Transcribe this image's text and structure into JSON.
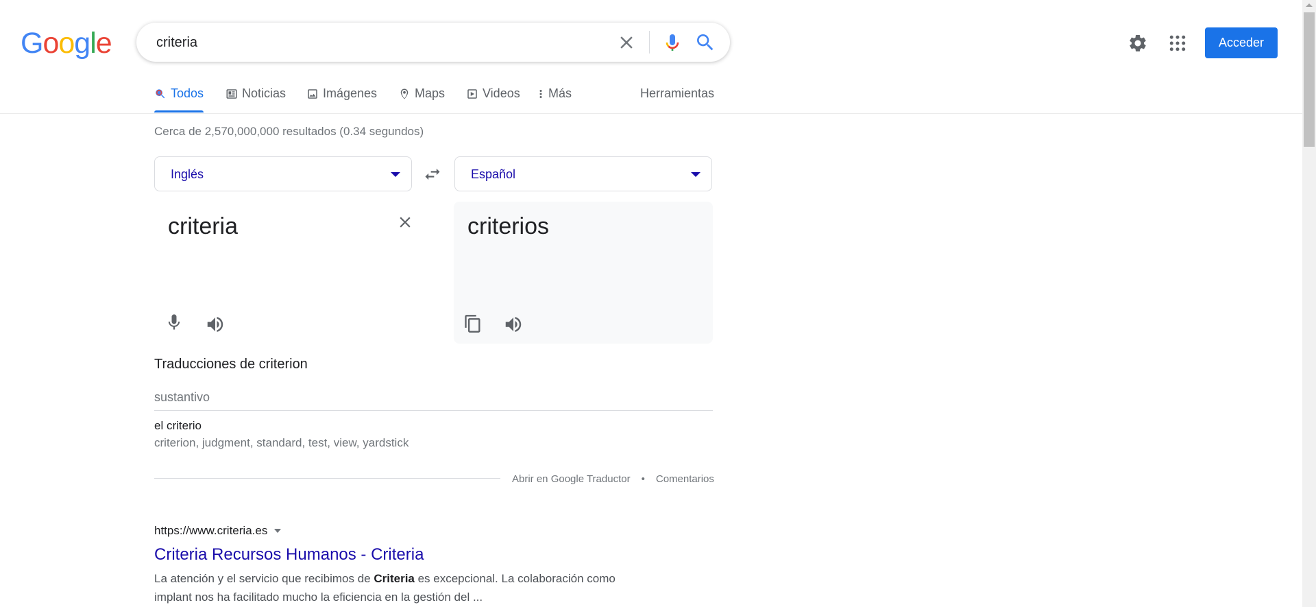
{
  "logo": {
    "letters": [
      "G",
      "o",
      "o",
      "g",
      "l",
      "e"
    ],
    "colors": [
      "#4285f4",
      "#ea4335",
      "#fbbc05",
      "#4285f4",
      "#34a853",
      "#ea4335"
    ]
  },
  "search": {
    "query": "criteria"
  },
  "header": {
    "signin_label": "Acceder"
  },
  "tabs": [
    {
      "label": "Todos",
      "icon": "search-icon",
      "active": true
    },
    {
      "label": "Noticias",
      "icon": "news-icon"
    },
    {
      "label": "Imágenes",
      "icon": "image-icon"
    },
    {
      "label": "Maps",
      "icon": "map-pin-icon"
    },
    {
      "label": "Videos",
      "icon": "video-icon"
    },
    {
      "label": "Más",
      "icon": "more-vert-icon"
    }
  ],
  "tools_label": "Herramientas",
  "result_stats": "Cerca de 2,570,000,000 resultados (0.34 segundos)",
  "translator": {
    "source_lang": "Inglés",
    "target_lang": "Español",
    "source_text": "criteria",
    "target_text": "criterios",
    "translations_heading": "Traducciones de criterion",
    "part_of_speech": "sustantivo",
    "term": "el criterio",
    "synonyms": "criterion, judgment, standard, test, view, yardstick",
    "open_link": "Abrir en Google Traductor",
    "separator": "•",
    "feedback_link": "Comentarios"
  },
  "result": {
    "url": "https://www.criteria.es",
    "title": "Criteria Recursos Humanos - Criteria",
    "snippet_before": "La atención y el servicio que recibimos de ",
    "snippet_bold": "Criteria",
    "snippet_after": " es excepcional. La colaboración como implant nos ha facilitado mucho la eficiencia en la gestión del ..."
  },
  "colors": {
    "accent": "#1a73e8",
    "link": "#1a0dab",
    "muted": "#70757a"
  }
}
